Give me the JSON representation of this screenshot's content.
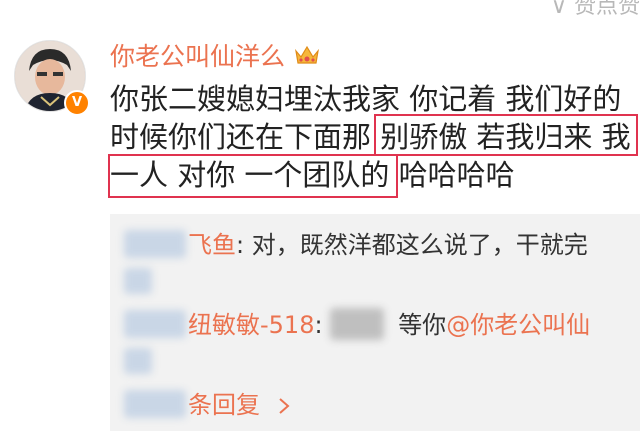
{
  "corner": {
    "text": "∨ 赞点赞"
  },
  "post": {
    "username": "你老公叫仙洋么",
    "verified_mark": "V",
    "lines": [
      "你张二嫂媳妇埋汰我家  你记着 我们好的",
      "时候你们还在下面那 别骄傲 若我归来 我",
      "一人 对你 一个团队的 哈哈哈哈"
    ]
  },
  "replies": [
    {
      "user_suffix": "飞鱼",
      "sep": ": ",
      "text": "对，既然洋都这么说了，干就完"
    },
    {
      "user_suffix": "纽敏敏-518",
      "sep": ": ",
      "text": "等你",
      "mention": "@你老公叫仙"
    },
    {
      "text": "条回复"
    }
  ],
  "colors": {
    "accent": "#eb7350",
    "highlight_border": "#e0334f",
    "reply_bg": "#f2f2f2",
    "text": "#222222"
  },
  "icons": [
    "crown-icon",
    "verified-icon",
    "chevron-right-icon"
  ]
}
